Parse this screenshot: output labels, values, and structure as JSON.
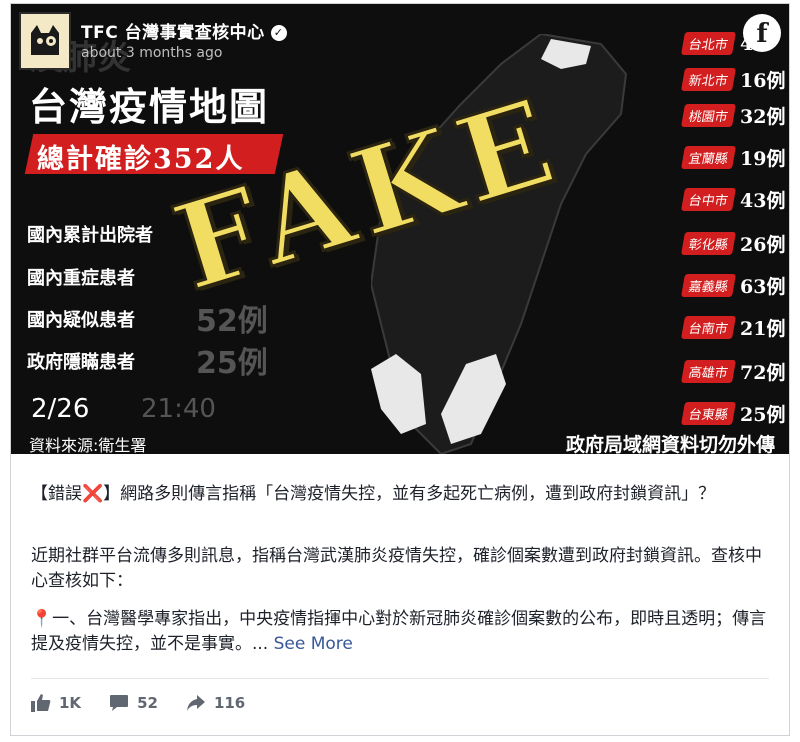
{
  "post": {
    "page_name": "TFC 台灣事實查核中心",
    "timestamp": "about 3 months ago",
    "fb_logo": "f",
    "icons": {
      "verified": "check-circle-icon",
      "facebook": "facebook-logo-icon"
    }
  },
  "image": {
    "heading_top": "漢肺炎",
    "heading": "台灣疫情地圖",
    "total_label": "總計確診352人",
    "stats": [
      {
        "label": "國內累計出院者",
        "value": ""
      },
      {
        "label": "國內重症患者",
        "value": ""
      },
      {
        "label": "國內疑似患者",
        "value": "52例"
      },
      {
        "label": "政府隱瞞患者",
        "value": "25例"
      }
    ],
    "date": "2/26",
    "time": "21:40",
    "source": "資料來源:衛生署",
    "footer_note": "政府局域網資料切勿外傳",
    "stamp": "FAKE",
    "stamp_color": "#f2dd63",
    "accent_color": "#d21e1e",
    "cities": [
      {
        "name": "台北市",
        "count": "4"
      },
      {
        "name": "新北市",
        "count": "16例"
      },
      {
        "name": "桃園市",
        "count": "32例"
      },
      {
        "name": "宜蘭縣",
        "count": "19例"
      },
      {
        "name": "台中市",
        "count": "43例"
      },
      {
        "name": "彰化縣",
        "count": "26例"
      },
      {
        "name": "嘉義縣",
        "count": "63例"
      },
      {
        "name": "台南市",
        "count": "21例"
      },
      {
        "name": "高雄市",
        "count": "72例"
      },
      {
        "name": "台東縣",
        "count": "25例"
      }
    ]
  },
  "text": {
    "p1": "【錯誤❌】網路多則傳言指稱「台灣疫情失控，並有多起死亡病例，遭到政府封鎖資訊」？",
    "p2": "近期社群平台流傳多則訊息，指稱台灣武漢肺炎疫情失控，確診個案數遭到政府封鎖資訊。查核中心查核如下：",
    "p3": "📍一、台灣醫學專家指出，中央疫情指揮中心對於新冠肺炎確診個案數的公布，即時且透明；傳言提及疫情失控，並不是事實。...",
    "see_more": "See More"
  },
  "actions": {
    "likes": "1K",
    "comments": "52",
    "shares": "116",
    "icons": {
      "like": "thumbs-up-icon",
      "comment": "comment-icon",
      "share": "share-arrow-icon"
    }
  }
}
